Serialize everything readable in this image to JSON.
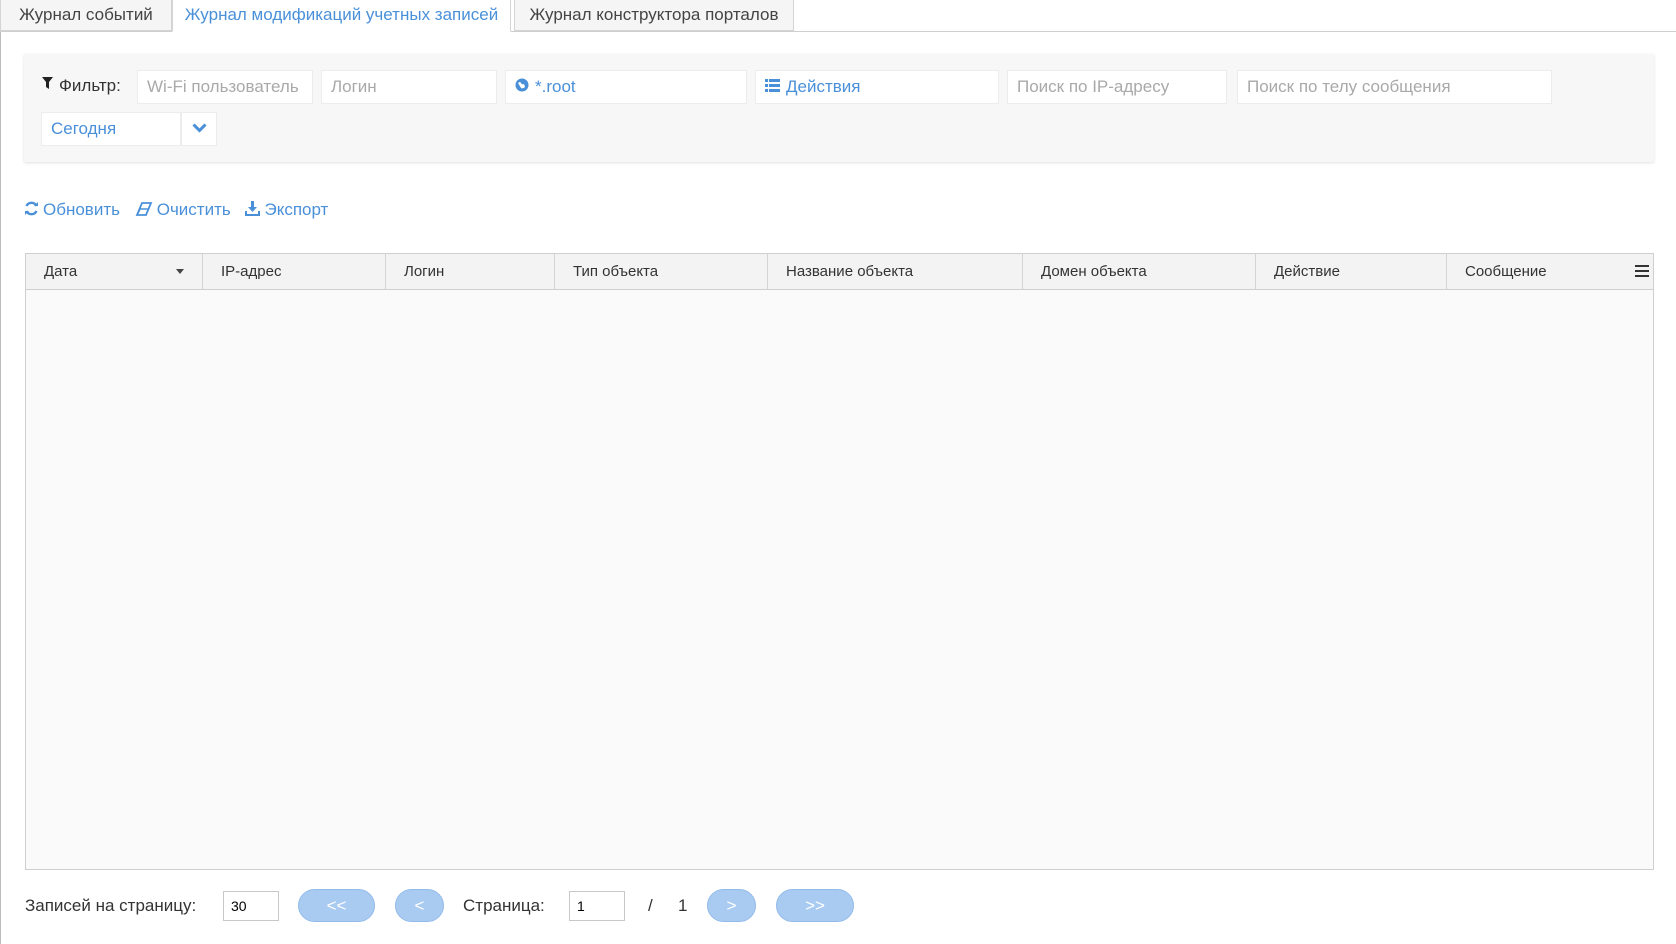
{
  "tabs": [
    {
      "label": "Журнал событий",
      "active": false
    },
    {
      "label": "Журнал модификаций учетных записей",
      "active": true
    },
    {
      "label": "Журнал конструктора порталов",
      "active": false
    }
  ],
  "filter": {
    "label": "Фильтр:",
    "wifi_user_placeholder": "Wi-Fi пользователь",
    "login_placeholder": "Логин",
    "domain_value": "*.root",
    "actions_value": "Действия",
    "ip_placeholder": "Поиск по IP-адресу",
    "message_placeholder": "Поиск по телу сообщения",
    "period_value": "Сегодня"
  },
  "toolbar": {
    "refresh_label": "Обновить",
    "clear_label": "Очистить",
    "export_label": "Экспорт"
  },
  "table": {
    "columns": [
      "Дата",
      "IP-адрес",
      "Логин",
      "Тип объекта",
      "Название объекта",
      "Домен объекта",
      "Действие",
      "Сообщение"
    ],
    "rows": []
  },
  "pager": {
    "per_page_label": "Записей на страницу:",
    "per_page_value": "30",
    "first_label": "<<",
    "prev_label": "<",
    "page_label": "Страница:",
    "page_value": "1",
    "separator": "/",
    "total_pages": "1",
    "next_label": ">",
    "last_label": ">>"
  },
  "colors": {
    "accent": "#4a90d9",
    "pager_button": "#a9cbf2"
  }
}
